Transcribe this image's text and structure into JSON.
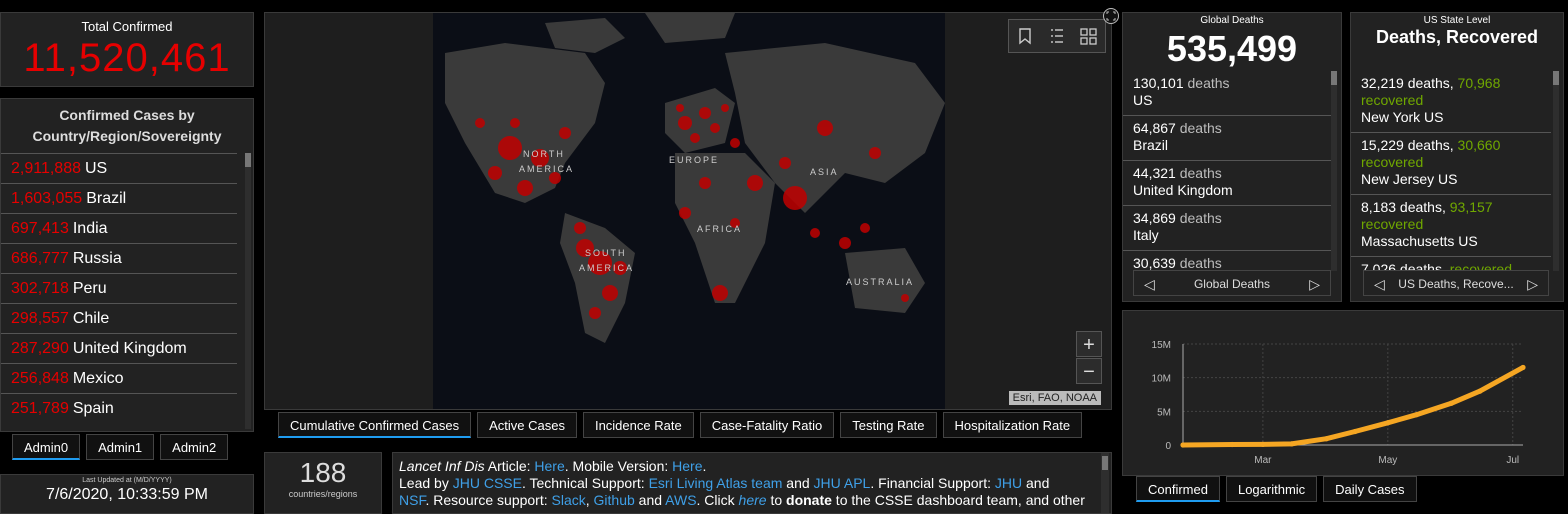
{
  "total": {
    "label": "Total Confirmed",
    "value": "11,520,461"
  },
  "countries": {
    "header": "Confirmed Cases by Country/Region/Sovereignty",
    "rows": [
      {
        "count": "2,911,888",
        "name": "US"
      },
      {
        "count": "1,603,055",
        "name": "Brazil"
      },
      {
        "count": "697,413",
        "name": "India"
      },
      {
        "count": "686,777",
        "name": "Russia"
      },
      {
        "count": "302,718",
        "name": "Peru"
      },
      {
        "count": "298,557",
        "name": "Chile"
      },
      {
        "count": "287,290",
        "name": "United Kingdom"
      },
      {
        "count": "256,848",
        "name": "Mexico"
      },
      {
        "count": "251,789",
        "name": "Spain"
      }
    ]
  },
  "admin_tabs": [
    "Admin0",
    "Admin1",
    "Admin2"
  ],
  "updated": {
    "label": "Last Updated at (M/D/YYYY)",
    "value": "7/6/2020, 10:33:59 PM"
  },
  "map": {
    "labels": {
      "na1": "NORTH",
      "na2": "AMERICA",
      "eu": "EUROPE",
      "as": "ASIA",
      "af": "AFRICA",
      "sa1": "SOUTH",
      "sa2": "AMERICA",
      "au": "AUSTRALIA"
    },
    "zoom_in": "+",
    "zoom_out": "−",
    "attribution": "Esri, FAO, NOAA",
    "tabs": [
      "Cumulative Confirmed Cases",
      "Active Cases",
      "Incidence Rate",
      "Case-Fatality Ratio",
      "Testing Rate",
      "Hospitalization Rate"
    ]
  },
  "regions": {
    "count": "188",
    "label": "countries/regions"
  },
  "info": {
    "t1": "Lancet Inf Dis",
    "t2": " Article: ",
    "l1": "Here",
    "t3": ". Mobile Version: ",
    "l2": "Here",
    "t4": ".",
    "t5": "Lead by ",
    "l3": "JHU CSSE",
    "t6": ". Technical Support: ",
    "l4": "Esri Living Atlas team",
    "t7": " and ",
    "l5": "JHU APL",
    "t8": ". Financial Support: ",
    "l6": "JHU",
    "t9": " and",
    "l7": "NSF",
    "t10": ". Resource support: ",
    "l8": "Slack",
    "t11": ", ",
    "l9": "Github",
    "t12": " and ",
    "l10": "AWS",
    "t13": ". Click ",
    "l11": "here",
    "t14": " to ",
    "b1": "donate",
    "t15": " to the CSSE dashboard team, and other"
  },
  "global_deaths": {
    "label": "Global Deaths",
    "value": "535,499",
    "word": " deaths",
    "rows": [
      {
        "count": "130,101",
        "name": "US"
      },
      {
        "count": "64,867",
        "name": "Brazil"
      },
      {
        "count": "44,321",
        "name": "United Kingdom"
      },
      {
        "count": "34,869",
        "name": "Italy"
      },
      {
        "count": "30,639",
        "name": ""
      }
    ],
    "pager": "Global Deaths"
  },
  "us_deaths": {
    "label": "US State Level",
    "title": "Deaths, Recovered",
    "deaths_word": " deaths, ",
    "recovered_word": "recovered",
    "rows": [
      {
        "deaths": "32,219",
        "recovered": "70,968",
        "name": "New York US"
      },
      {
        "deaths": "15,229",
        "recovered": "30,660",
        "name": "New Jersey US"
      },
      {
        "deaths": "8,183",
        "recovered": "93,157",
        "name": "Massachusetts US"
      },
      {
        "deaths": "7,026",
        "recovered": "",
        "name": ""
      }
    ],
    "pager": "US Deaths, Recove..."
  },
  "chart_data": {
    "type": "line",
    "title": "",
    "xlabel": "",
    "ylabel": "",
    "x_ticks": [
      "Mar",
      "May",
      "Jul"
    ],
    "y_ticks": [
      "0",
      "5M",
      "10M",
      "15M"
    ],
    "ylim": [
      0,
      15000000
    ],
    "grid": true,
    "color": "#f5a623",
    "x": [
      "2020-01-22",
      "2020-02-15",
      "2020-03-01",
      "2020-03-15",
      "2020-04-01",
      "2020-04-15",
      "2020-05-01",
      "2020-05-15",
      "2020-06-01",
      "2020-06-15",
      "2020-07-06"
    ],
    "values": [
      0,
      70000,
      90000,
      170000,
      930000,
      2000000,
      3300000,
      4500000,
      6200000,
      8000000,
      11520000
    ]
  },
  "chart_tabs": [
    "Confirmed",
    "Logarithmic",
    "Daily Cases"
  ],
  "colors": {
    "accent_red": "#e60000",
    "recovered_green": "#70a800",
    "link_blue": "#3fa0e8",
    "tab_active": "#1f9cf0"
  }
}
